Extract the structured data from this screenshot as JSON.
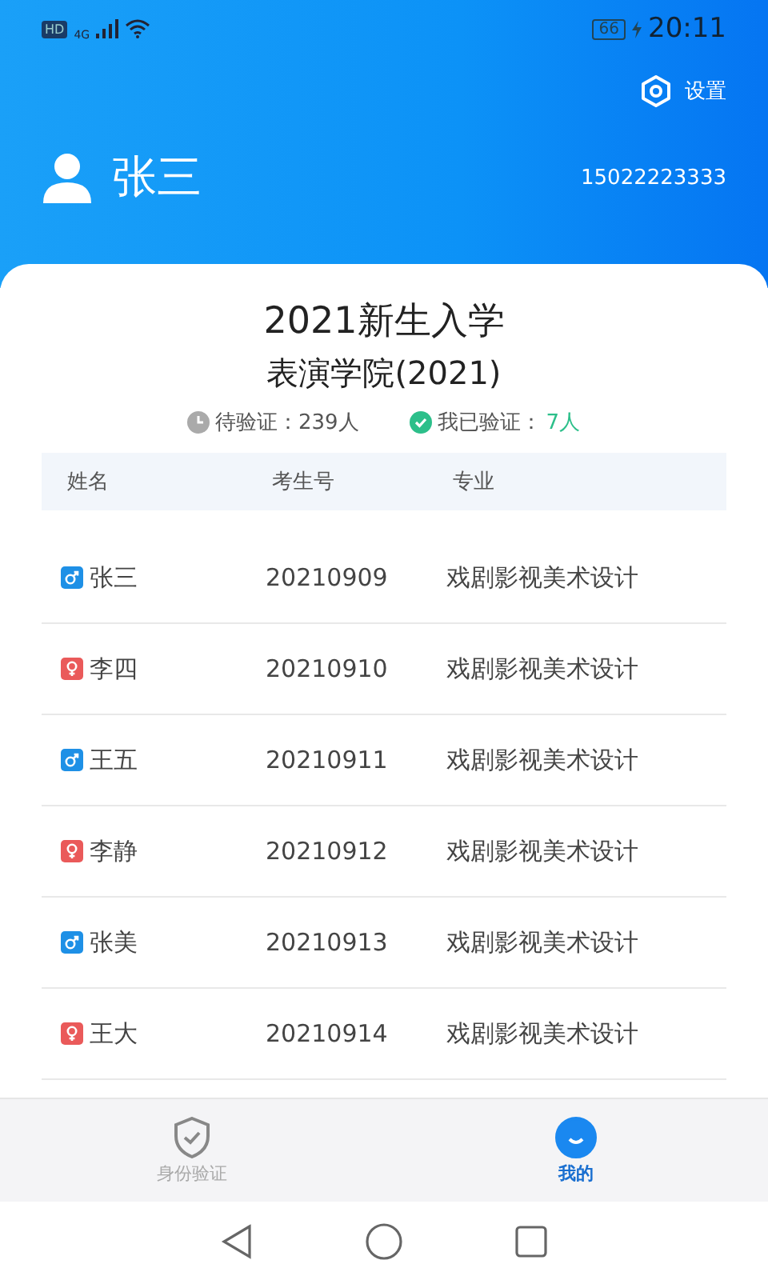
{
  "status_bar": {
    "network_badge": "HD",
    "network_type": "4G",
    "battery": "66",
    "time": "20:11"
  },
  "header": {
    "settings_label": "设置",
    "user_name": "张三",
    "phone": "15022223333"
  },
  "title": "2021新生入学",
  "subtitle": "表演学院(2021)",
  "stats": {
    "pending": "待验证：239人",
    "verified_label": "我已验证：",
    "verified_count": "7人"
  },
  "table": {
    "columns": [
      "姓名",
      "考生号",
      "专业"
    ],
    "rows": [
      {
        "kind": "male",
        "name": "张三",
        "id": "20210909",
        "major": "戏剧影视美术设计"
      },
      {
        "kind": "female",
        "name": "李四",
        "id": "20210910",
        "major": "戏剧影视美术设计"
      },
      {
        "kind": "male",
        "name": "王五",
        "id": "20210911",
        "major": "戏剧影视美术设计"
      },
      {
        "kind": "female",
        "name": "李静",
        "id": "20210912",
        "major": "戏剧影视美术设计"
      },
      {
        "kind": "male",
        "name": "张美",
        "id": "20210913",
        "major": "戏剧影视美术设计"
      },
      {
        "kind": "female",
        "name": "王大",
        "id": "20210914",
        "major": "戏剧影视美术设计"
      }
    ]
  },
  "tabs": [
    {
      "label": "身份验证",
      "selected": false
    },
    {
      "label": "我的",
      "selected": true
    }
  ]
}
